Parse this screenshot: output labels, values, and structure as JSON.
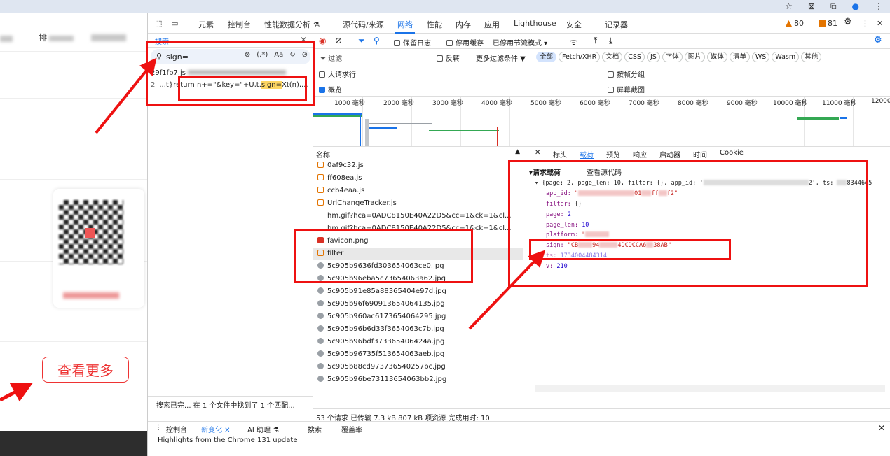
{
  "browser": {
    "icons": [
      "star-icon",
      "extension-icon",
      "puzzle-icon",
      "profile-icon",
      "more-icon"
    ]
  },
  "page": {
    "nav_text": "排",
    "more_button": "查看更多"
  },
  "devtools": {
    "tabs": [
      "元素",
      "控制台",
      "性能数据分析 ⚗",
      "源代码/来源",
      "网络",
      "性能",
      "内存",
      "应用",
      "Lighthouse",
      "安全",
      "记录器"
    ],
    "active_tab": "网络",
    "warnings": "80",
    "errors": "81",
    "search": {
      "title": "搜索",
      "query": "sign=",
      "opt_regex": "(.*)",
      "opt_case": "Aa",
      "result_file": "29f1fb7.js",
      "result_line_no": "2",
      "result_line_prefix": "...t}return n+=\"&key=\"+U,t.",
      "result_line_match": "sign=",
      "result_line_suffix": "Xt(n),...",
      "status": "搜索已完...    在 1 个文件中找到了 1 个匹配..."
    },
    "network": {
      "preserve_log": "保留日志",
      "disable_cache": "停用缓存",
      "throttle": "已停用节流模式",
      "filter_placeholder": "过滤",
      "invert": "反转",
      "more_filters": "更多过滤条件 ▼",
      "type_chips": [
        "全部",
        "Fetch/XHR",
        "文档",
        "CSS",
        "JS",
        "字体",
        "图片",
        "媒体",
        "清单",
        "WS",
        "Wasm",
        "其他"
      ],
      "big_rows": "大请求行",
      "group_by_frame": "按帧分组",
      "overview": "概览",
      "screenshots": "屏幕截图",
      "timeline_ticks": [
        "1000 毫秒",
        "2000 毫秒",
        "3000 毫秒",
        "4000 毫秒",
        "5000 毫秒",
        "6000 毫秒",
        "7000 毫秒",
        "8000 毫秒",
        "9000 毫秒",
        "10000 毫秒",
        "11000 毫秒",
        "12000"
      ],
      "list_header": "名称",
      "requests": [
        {
          "name": "0af9c32.js",
          "type": "js"
        },
        {
          "name": "ff608ea.js",
          "type": "js"
        },
        {
          "name": "ccb4eaa.js",
          "type": "js"
        },
        {
          "name": "UrlChangeTracker.js",
          "type": "js"
        },
        {
          "name": "hm.gif?hca=0ADC8150E40A22D5&cc=1&ck=1&cl...",
          "type": "gif"
        },
        {
          "name": "hm.gif?hca=0ADC8150E40A22D5&cc=1&ck=1&cl...",
          "type": "gif"
        },
        {
          "name": "favicon.png",
          "type": "png"
        },
        {
          "name": "filter",
          "type": "xhr"
        },
        {
          "name": "5c905b9636fd303654063ce0.jpg",
          "type": "img"
        },
        {
          "name": "5c905b96eba5c73654063a62.jpg",
          "type": "img"
        },
        {
          "name": "5c905b91e85a88365404e97d.jpg",
          "type": "img"
        },
        {
          "name": "5c905b96f690913654064135.jpg",
          "type": "img"
        },
        {
          "name": "5c905b960ac6173654064295.jpg",
          "type": "img"
        },
        {
          "name": "5c905b96b6d33f3654063c7b.jpg",
          "type": "img"
        },
        {
          "name": "5c905b96bdf373365406424a.jpg",
          "type": "img"
        },
        {
          "name": "5c905b96735f513654063aeb.jpg",
          "type": "img"
        },
        {
          "name": "5c905b88cd973736540257bc.jpg",
          "type": "img"
        },
        {
          "name": "5c905b96be73113654063bb2.jpg",
          "type": "img"
        }
      ],
      "detail_tabs": [
        "标头",
        "载荷",
        "预览",
        "响应",
        "启动器",
        "时间",
        "Cookie"
      ],
      "detail_active": "载荷",
      "payload_title": "▾请求载荷",
      "view_source": "查看源代码",
      "payload_summary": "▾ {page: 2, page_len: 10, filter: {}, app_id: '",
      "payload_summary_tail": "2', ts: ",
      "payload_ts_tail": "8344645",
      "payload": {
        "app_id_key": "app_id:",
        "app_id_val_a": "\"",
        "app_id_val_b": "01",
        "app_id_val_c": "ff",
        "app_id_val_d": "f2\"",
        "filter_key": "filter:",
        "filter_val": "{}",
        "page_key": "page:",
        "page_val": "2",
        "page_len_key": "page_len:",
        "page_len_val": "10",
        "platform_key": "platform:",
        "platform_val": "\"",
        "sign_key": "sign:",
        "sign_val_a": "\"CB",
        "sign_val_b": "94",
        "sign_val_c": "4DCDCCA6",
        "sign_val_d": "38AB\"",
        "ts_key": "ts:",
        "ts_val": "1734004484314",
        "v_key": "v:",
        "v_val": "210"
      },
      "status_bar": "53 个请求   已传输 7.3 kB   807 kB 项资源   完成用时: 10"
    },
    "drawer": {
      "tabs": [
        "控制台",
        "新变化",
        "AI 助理 ⚗",
        "搜索",
        "覆盖率"
      ],
      "active_tab": "新变化",
      "highlight": "Highlights from the Chrome 131 update"
    }
  },
  "colors": {
    "annotation": "#ee1111",
    "accent": "#1a73e8"
  }
}
